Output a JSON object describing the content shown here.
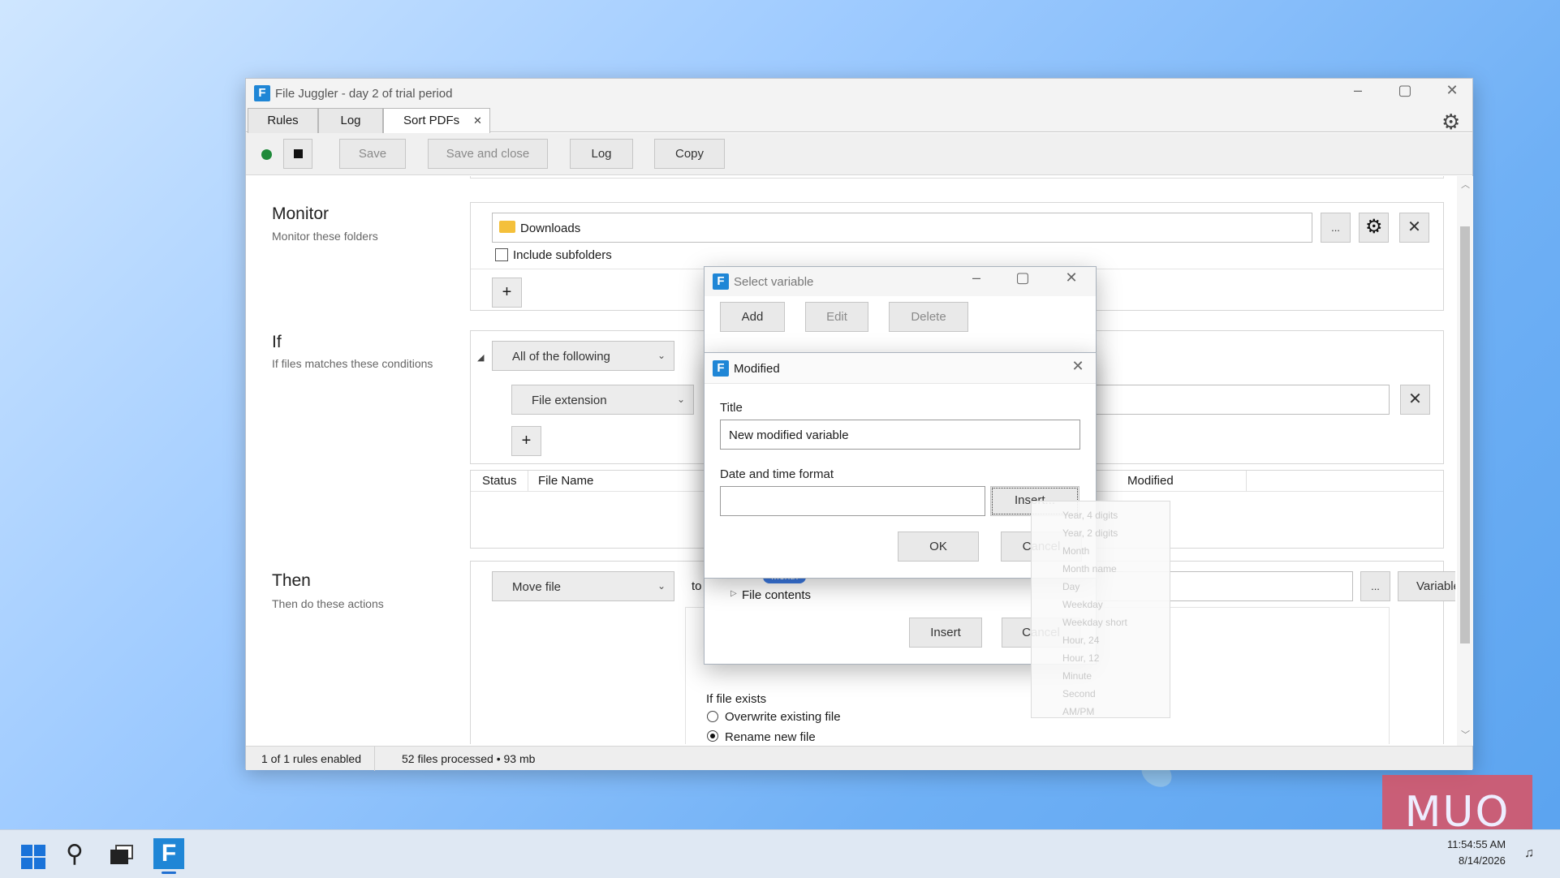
{
  "window": {
    "title": "File Juggler - day 2 of trial period",
    "logo_letter": "F",
    "tabs": [
      {
        "label": "Rules"
      },
      {
        "label": "Log"
      },
      {
        "label": "Sort PDFs",
        "close": "✕"
      }
    ]
  },
  "toolbar": {
    "save": "Save",
    "save_close": "Save and close",
    "log": "Log",
    "copy": "Copy"
  },
  "monitor": {
    "title": "Monitor",
    "subtitle": "Monitor these folders",
    "folder": "Downloads",
    "browse": "...",
    "include_subfolders": "Include subfolders",
    "add": "+"
  },
  "if_section": {
    "title": "If",
    "subtitle": "If files matches these conditions",
    "match_mode": "All of the following",
    "condition": "File extension",
    "add": "+"
  },
  "results_table": {
    "columns": [
      "Status",
      "File Name",
      "Modified"
    ]
  },
  "then_section": {
    "title": "Then",
    "subtitle": "Then do these actions",
    "action": "Move file",
    "to_label": "to",
    "browse": "...",
    "variables": "Variables...",
    "if_file_exists": "If file exists",
    "options": [
      "Overwrite existing file",
      "Rename new file"
    ],
    "selected_option": "Rename new file"
  },
  "statusbar": {
    "rules": "1 of 1 rules enabled",
    "files": "52 files processed • 93 mb"
  },
  "select_variable_dialog": {
    "title": "Select variable",
    "add": "Add",
    "edit": "Edit",
    "delete": "Delete",
    "tree_badge": "Month",
    "tree_item": "File contents",
    "insert": "Insert",
    "cancel": "Cancel"
  },
  "modified_dialog": {
    "title": "Modified",
    "title_label": "Title",
    "title_value": "New modified variable",
    "format_label": "Date and time format",
    "format_value": "",
    "insert": "Insert...",
    "ok": "OK",
    "cancel": "Cancel"
  },
  "insert_menu": {
    "items": [
      "Year, 4 digits",
      "Year, 2 digits",
      "Month",
      "Month name",
      "Day",
      "Weekday",
      "Weekday short",
      "Hour, 24",
      "Hour, 12",
      "Minute",
      "Second",
      "AM/PM"
    ]
  },
  "taskbar": {
    "time": "11:54:55 AM",
    "date": "8/14/2026"
  },
  "watermark": "MUO",
  "colors": {
    "accent": "#1f86d6",
    "running_dot": "#1f8a3a",
    "watermark": "#e04e5c"
  }
}
